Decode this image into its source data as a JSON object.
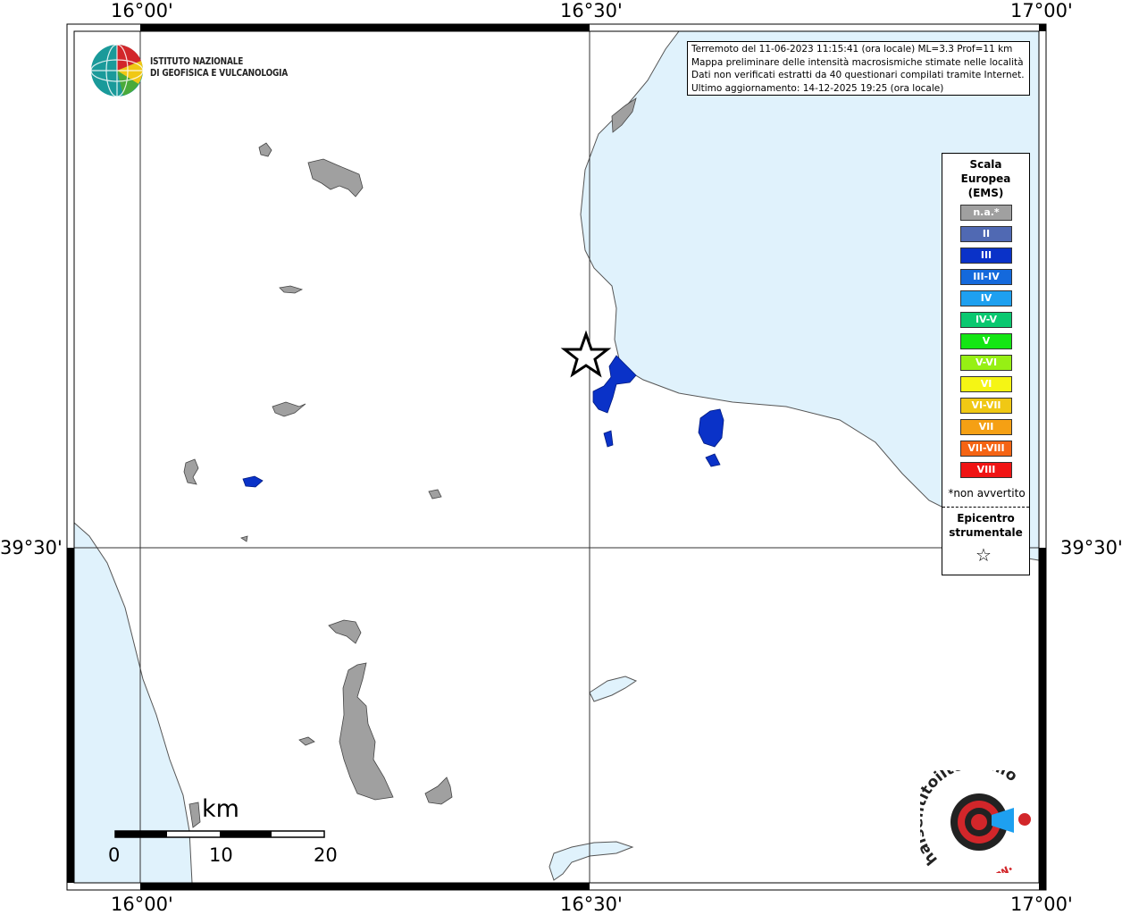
{
  "axes": {
    "top_ticks": [
      "16°00'",
      "16°30'",
      "17°00'"
    ],
    "bottom_ticks": [
      "16°00'",
      "16°30'",
      "17°00'"
    ],
    "left_tick": "39°30'",
    "right_tick": "39°30'"
  },
  "header": {
    "lines": [
      "Terremoto del 11-06-2023 11:15:41 (ora locale) ML=3.3 Prof=11 km",
      "Mappa preliminare delle intensità macrosismiche stimate nelle località",
      "Dati non verificati estratti da 40 questionari compilati tramite Internet.",
      "Ultimo aggiornamento: 14-12-2025 19:25 (ora locale)"
    ]
  },
  "institute": {
    "line1": "ISTITUTO NAZIONALE",
    "line2": "DI GEOFISICA E VULCANOLOGIA"
  },
  "legend": {
    "title_lines": [
      "Scala",
      "Europea",
      "(EMS)"
    ],
    "items": [
      {
        "label": "n.a.*",
        "color": "#a0a0a0"
      },
      {
        "label": "II",
        "color": "#5069b3"
      },
      {
        "label": "III",
        "color": "#0a32c8"
      },
      {
        "label": "III-IV",
        "color": "#1469dc"
      },
      {
        "label": "IV",
        "color": "#1ea0f0"
      },
      {
        "label": "IV-V",
        "color": "#0ac870"
      },
      {
        "label": "V",
        "color": "#14e614"
      },
      {
        "label": "V-VI",
        "color": "#96f014"
      },
      {
        "label": "VI",
        "color": "#f5f514"
      },
      {
        "label": "VI-VII",
        "color": "#f0c814"
      },
      {
        "label": "VII",
        "color": "#f5a014"
      },
      {
        "label": "VII-VIII",
        "color": "#f56414"
      },
      {
        "label": "VIII",
        "color": "#f01414"
      }
    ],
    "note": "*non avvertito",
    "epicenter_lines": [
      "Epicentro",
      "strumentale"
    ]
  },
  "scalebar": {
    "unit": "km",
    "labels": [
      "0",
      "10",
      "20"
    ]
  },
  "logo_hs": {
    "text": "haisentitoilterremoto.it",
    "www": "www."
  },
  "colors": {
    "sea": "#e0f2fc",
    "land": "#ffffff",
    "na": "#a0a0a0",
    "iii": "#0a32c8"
  }
}
